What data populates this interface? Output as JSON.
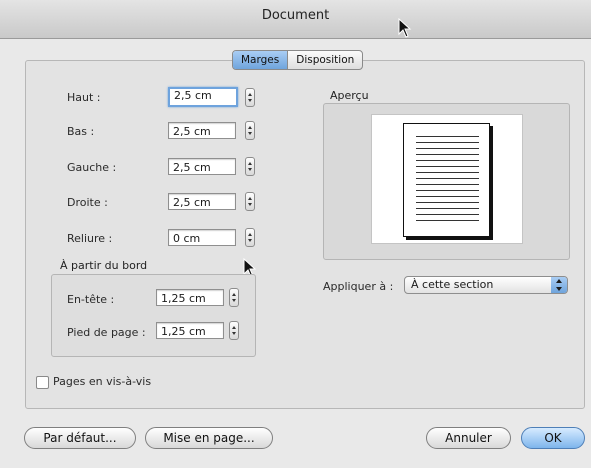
{
  "window": {
    "title": "Document"
  },
  "tabs": [
    {
      "label": "Marges",
      "active": true
    },
    {
      "label": "Disposition",
      "active": false
    }
  ],
  "margins": [
    {
      "label": "Haut :",
      "value": "2,5 cm",
      "focused": true
    },
    {
      "label": "Bas :",
      "value": "2,5 cm",
      "focused": false
    },
    {
      "label": "Gauche :",
      "value": "2,5 cm",
      "focused": false
    },
    {
      "label": "Droite :",
      "value": "2,5 cm",
      "focused": false
    },
    {
      "label": "Reliure :",
      "value": "0 cm",
      "focused": false
    }
  ],
  "from_edge": {
    "title": "À partir du bord",
    "header": {
      "label": "En-tête :",
      "value": "1,25 cm"
    },
    "footer": {
      "label": "Pied de page :",
      "value": "1,25 cm"
    }
  },
  "preview": {
    "title": "Aperçu"
  },
  "apply": {
    "label": "Appliquer à :",
    "value": "À cette section"
  },
  "mirror": {
    "label": "Pages en vis-à-vis",
    "checked": false
  },
  "buttons": {
    "default": "Par défaut...",
    "page_setup": "Mise en page...",
    "cancel": "Annuler",
    "ok": "OK"
  },
  "colors": {
    "accent": "#7eb5ec",
    "tab_active": "#6fa4dc"
  },
  "icons": {
    "cursor": "mouse-pointer-icon"
  }
}
